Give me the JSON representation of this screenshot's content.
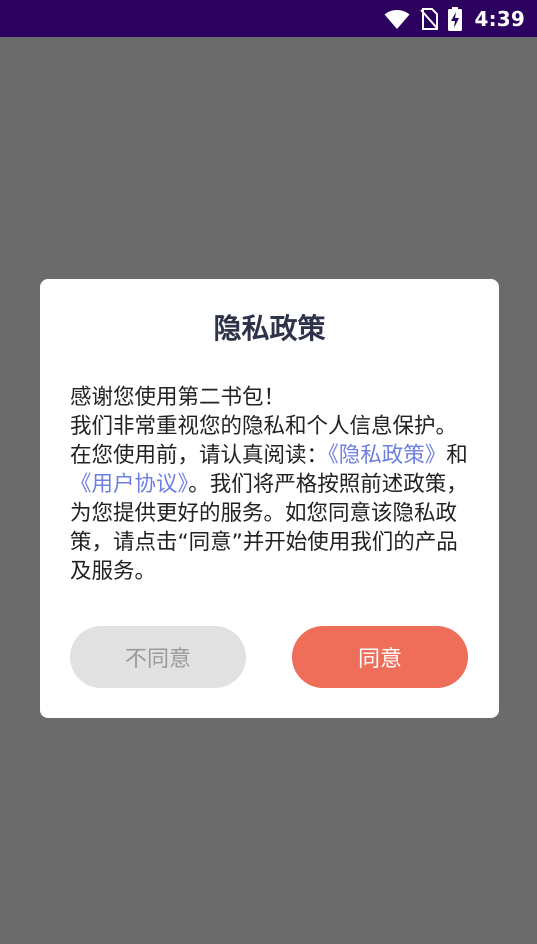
{
  "status_bar": {
    "time": "4:39",
    "icons": [
      "wifi-icon",
      "no-sim-icon",
      "battery-charging-icon"
    ],
    "background_color": "#2b005e"
  },
  "dialog": {
    "title": "隐私政策",
    "body": {
      "line1": "感谢您使用第二书包！",
      "part1": "我们非常重视您的隐私和个人信息保护。在您使用前，请认真阅读：",
      "privacy_link": "《隐私政策》",
      "and": "和",
      "user_agreement_link": "《用户协议》",
      "part2": "。我们将严格按照前述政策，为您提供更好的服务。如您同意该隐私政策，请点击“同意”并开始使用我们的产品及服务。"
    },
    "buttons": {
      "disagree_label": "不同意",
      "agree_label": "同意"
    },
    "colors": {
      "title": "#2f3349",
      "link": "#6d7fe0",
      "agree_button": "#ee6e5a",
      "disagree_button": "#e1e1e1"
    }
  },
  "overlay_color": "#6b6b6b"
}
